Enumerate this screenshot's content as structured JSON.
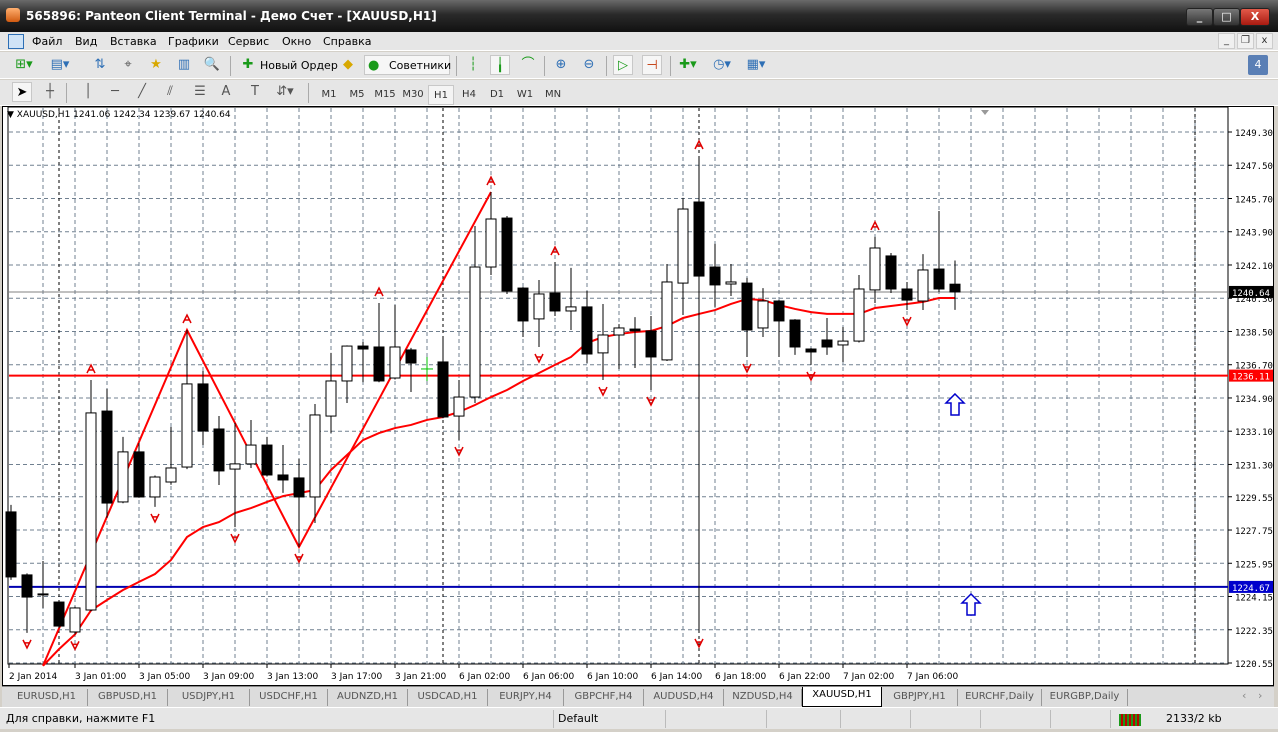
{
  "window": {
    "title": "565896: Panteon Client Terminal - Демо Счет - [XAUUSD,H1]",
    "minimize": "_",
    "maximize": "□",
    "close": "X"
  },
  "menu": [
    "Файл",
    "Вид",
    "Вставка",
    "Графики",
    "Сервис",
    "Окно",
    "Справка"
  ],
  "mdi": {
    "minimize": "_",
    "restore": "❐",
    "close": "x"
  },
  "toolbar": {
    "new_order": "Новый Ордер",
    "experts": "Советники",
    "alerts_count": "4"
  },
  "timeframes": [
    "M1",
    "M5",
    "M15",
    "M30",
    "H1",
    "H4",
    "D1",
    "W1",
    "MN"
  ],
  "selected_timeframe": "H1",
  "chart_header": "XAUUSD,H1  1241.06 1242.34 1239.67 1240.64",
  "chart_data": {
    "type": "candlestick",
    "symbol": "XAUUSD",
    "timeframe": "H1",
    "ylim": [
      1220.55,
      1249.3
    ],
    "y_ticks": [
      "1249.30",
      "1247.50",
      "1245.70",
      "1243.90",
      "1242.10",
      "1240.30",
      "1238.50",
      "1236.70",
      "1234.90",
      "1233.10",
      "1231.30",
      "1229.55",
      "1227.75",
      "1225.95",
      "1224.15",
      "1222.35",
      "1220.55"
    ],
    "x_ticks": [
      {
        "bar": 0,
        "label": "2 Jan 2014"
      },
      {
        "bar": 4,
        "label": "3 Jan 01:00"
      },
      {
        "bar": 8,
        "label": "3 Jan 05:00"
      },
      {
        "bar": 12,
        "label": "3 Jan 09:00"
      },
      {
        "bar": 16,
        "label": "3 Jan 13:00"
      },
      {
        "bar": 20,
        "label": "3 Jan 17:00"
      },
      {
        "bar": 24,
        "label": "3 Jan 21:00"
      },
      {
        "bar": 28,
        "label": "6 Jan 02:00"
      },
      {
        "bar": 32,
        "label": "6 Jan 06:00"
      },
      {
        "bar": 36,
        "label": "6 Jan 10:00"
      },
      {
        "bar": 40,
        "label": "6 Jan 14:00"
      },
      {
        "bar": 44,
        "label": "6 Jan 18:00"
      },
      {
        "bar": 48,
        "label": "6 Jan 22:00"
      },
      {
        "bar": 52,
        "label": "7 Jan 02:00"
      },
      {
        "bar": 56,
        "label": "7 Jan 06:00"
      }
    ],
    "ohlc": [
      [
        1228.73,
        1229.11,
        1225.05,
        1225.21
      ],
      [
        1225.32,
        1225.4,
        1222.18,
        1224.12
      ],
      [
        1224.29,
        1226.07,
        1223.53,
        1224.29
      ],
      [
        1223.85,
        1223.9,
        1222.45,
        1222.55
      ],
      [
        1222.23,
        1223.6,
        1222.1,
        1223.53
      ],
      [
        1223.42,
        1235.87,
        1223.35,
        1234.09
      ],
      [
        1234.19,
        1235.39,
        1228.4,
        1229.21
      ],
      [
        1229.27,
        1232.79,
        1229.2,
        1231.98
      ],
      [
        1231.98,
        1232.46,
        1229.5,
        1229.54
      ],
      [
        1229.54,
        1230.7,
        1229.0,
        1230.62
      ],
      [
        1230.35,
        1233.33,
        1230.2,
        1231.11
      ],
      [
        1231.16,
        1238.58,
        1231.05,
        1235.66
      ],
      [
        1235.66,
        1236.36,
        1232.35,
        1233.11
      ],
      [
        1233.22,
        1233.92,
        1230.19,
        1230.95
      ],
      [
        1231.05,
        1233.55,
        1227.91,
        1231.33
      ],
      [
        1231.33,
        1233.71,
        1231.11,
        1232.35
      ],
      [
        1232.35,
        1232.79,
        1230.65,
        1230.73
      ],
      [
        1230.73,
        1232.35,
        1229.76,
        1230.46
      ],
      [
        1230.57,
        1231.6,
        1226.83,
        1229.54
      ],
      [
        1229.54,
        1234.57,
        1228.13,
        1233.98
      ],
      [
        1233.92,
        1237.34,
        1233.0,
        1235.82
      ],
      [
        1235.82,
        1237.75,
        1234.63,
        1237.71
      ],
      [
        1237.71,
        1237.93,
        1235.76,
        1237.55
      ],
      [
        1237.66,
        1240.04,
        1235.75,
        1235.82
      ],
      [
        1235.98,
        1239.93,
        1235.9,
        1237.66
      ],
      [
        1237.5,
        1237.61,
        1235.22,
        1236.79
      ],
      [
        1236.47,
        1237.12,
        1235.82,
        1236.47
      ],
      [
        1236.85,
        1238.2,
        1233.8,
        1233.87
      ],
      [
        1233.92,
        1235.87,
        1232.62,
        1234.95
      ],
      [
        1234.95,
        1244.21,
        1234.63,
        1241.99
      ],
      [
        1241.99,
        1246.05,
        1241.56,
        1244.59
      ],
      [
        1244.64,
        1244.75,
        1240.53,
        1240.69
      ],
      [
        1240.85,
        1240.9,
        1238.2,
        1239.07
      ],
      [
        1239.18,
        1241.29,
        1237.66,
        1240.53
      ],
      [
        1240.58,
        1242.26,
        1239.34,
        1239.61
      ],
      [
        1239.61,
        1241.94,
        1238.58,
        1239.83
      ],
      [
        1239.83,
        1240.69,
        1236.79,
        1237.28
      ],
      [
        1237.34,
        1239.99,
        1235.87,
        1238.31
      ],
      [
        1238.31,
        1238.9,
        1236.47,
        1238.69
      ],
      [
        1238.63,
        1239.28,
        1236.52,
        1238.53
      ],
      [
        1238.53,
        1239.34,
        1235.33,
        1237.12
      ],
      [
        1236.96,
        1242.15,
        1236.9,
        1241.18
      ],
      [
        1241.12,
        1245.73,
        1239.39,
        1245.13
      ],
      [
        1245.51,
        1248.0,
        1222.23,
        1241.5
      ],
      [
        1241.99,
        1243.24,
        1239.83,
        1241.02
      ],
      [
        1241.07,
        1242.15,
        1240.42,
        1241.18
      ],
      [
        1241.12,
        1241.4,
        1237.12,
        1238.58
      ],
      [
        1238.69,
        1240.85,
        1238.2,
        1240.15
      ],
      [
        1240.15,
        1240.2,
        1237.12,
        1239.07
      ],
      [
        1239.12,
        1239.17,
        1237.23,
        1237.66
      ],
      [
        1237.55,
        1237.6,
        1236.69,
        1237.39
      ],
      [
        1238.04,
        1239.23,
        1237.23,
        1237.66
      ],
      [
        1237.77,
        1238.74,
        1236.85,
        1237.98
      ],
      [
        1237.98,
        1241.56,
        1237.9,
        1240.8
      ],
      [
        1240.75,
        1243.62,
        1240.04,
        1243.02
      ],
      [
        1242.59,
        1242.75,
        1240.58,
        1240.8
      ],
      [
        1240.8,
        1241.18,
        1239.66,
        1240.2
      ],
      [
        1240.15,
        1242.69,
        1239.66,
        1241.83
      ],
      [
        1241.88,
        1245.02,
        1240.64,
        1240.8
      ],
      [
        1241.06,
        1242.34,
        1239.67,
        1240.64
      ]
    ],
    "doji_green_bars": [
      26
    ],
    "ma_start_bar": 2,
    "ma": [
      1220.4,
      1221.3,
      1222.1,
      1223.4,
      1223.96,
      1224.5,
      1224.94,
      1225.37,
      1226.13,
      1227.37,
      1227.91,
      1228.18,
      1228.67,
      1228.94,
      1229.27,
      1229.59,
      1229.75,
      1229.92,
      1231.0,
      1231.81,
      1232.62,
      1233.0,
      1233.27,
      1233.44,
      1233.71,
      1233.87,
      1234.14,
      1234.52,
      1234.95,
      1235.33,
      1235.82,
      1236.25,
      1236.69,
      1237.12,
      1237.88,
      1238.2,
      1238.36,
      1238.47,
      1238.53,
      1238.8,
      1239.23,
      1239.45,
      1239.66,
      1239.99,
      1240.26,
      1240.2,
      1239.93,
      1239.72,
      1239.55,
      1239.45,
      1239.45,
      1239.45,
      1239.77,
      1239.88,
      1239.99,
      1240.1,
      1240.31,
      1240.31
    ],
    "zigzag": [
      [
        2,
        1220.4
      ],
      [
        11,
        1238.58
      ],
      [
        18,
        1226.83
      ],
      [
        30,
        1246.05
      ]
    ],
    "fractals_up": [
      5,
      11,
      23,
      30,
      34,
      43,
      54
    ],
    "fractals_down": [
      1,
      4,
      9,
      14,
      18,
      28,
      33,
      37,
      40,
      43,
      46,
      50,
      56
    ],
    "hlines": [
      {
        "price": 1240.64,
        "label": "1240.64",
        "color": "#808080",
        "tag": "#000000"
      },
      {
        "price": 1236.11,
        "label": "1236.11",
        "color": "#ff0000",
        "tag": "#ff0000"
      },
      {
        "price": 1224.67,
        "label": "1224.67",
        "color": "#0000b0",
        "tag": "#0000cc"
      }
    ],
    "arrow_objects": [
      {
        "bar": 59,
        "price": 1234.52
      },
      {
        "bar": 60,
        "price": 1223.69
      }
    ],
    "period_separators": [
      3,
      27,
      43,
      74
    ]
  },
  "tabs": [
    "EURUSD,H1",
    "GBPUSD,H1",
    "USDJPY,H1",
    "USDCHF,H1",
    "AUDNZD,H1",
    "USDCAD,H1",
    "EURJPY,H4",
    "GBPCHF,H4",
    "AUDUSD,H4",
    "NZDUSD,H4",
    "XAUUSD,H1",
    "GBPJPY,H1",
    "EURCHF,Daily",
    "EURGBP,Daily"
  ],
  "active_tab": "XAUUSD,H1",
  "status": {
    "help": "Для справки, нажмите F1",
    "profile": "Default",
    "traffic": "2133/2 kb"
  },
  "colors": {
    "bull": "#ffffff",
    "bear": "#000000",
    "ma": "#ff0000",
    "zigzag": "#ff0000",
    "grid": "#708090",
    "arrow": "#0000cc"
  }
}
